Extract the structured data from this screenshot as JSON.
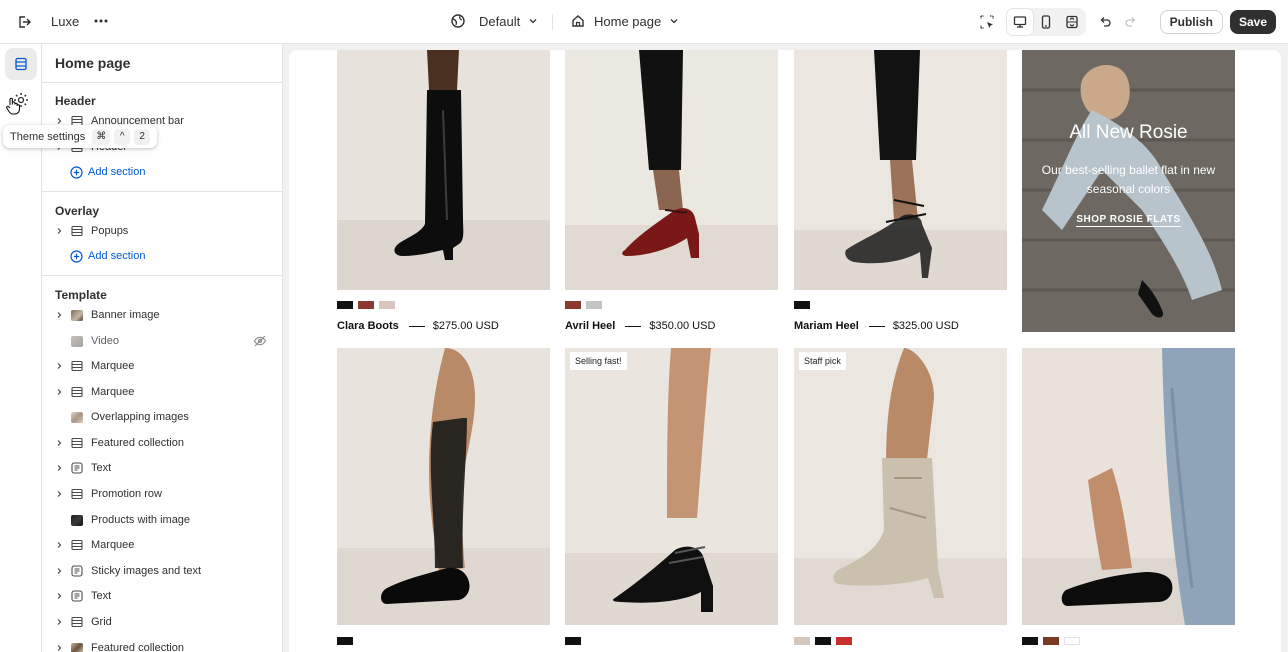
{
  "topbar": {
    "store_name": "Luxe",
    "theme_label": "Default",
    "page_label": "Home page",
    "publish_label": "Publish",
    "save_label": "Save"
  },
  "tooltip": {
    "label": "Theme settings",
    "keys": [
      "⌘",
      "^",
      "2"
    ]
  },
  "sidebar": {
    "title": "Home page",
    "groups": {
      "header": {
        "title": "Header",
        "items": [
          {
            "label": "Announcement bar",
            "icon": "section-icon"
          },
          {
            "label": "Header",
            "icon": "section-icon"
          }
        ],
        "add_label": "Add section"
      },
      "overlay": {
        "title": "Overlay",
        "items": [
          {
            "label": "Popups",
            "icon": "section-icon"
          }
        ],
        "add_label": "Add section"
      },
      "template": {
        "title": "Template",
        "items": [
          {
            "label": "Banner image",
            "icon": "image-thumb"
          },
          {
            "label": "Video",
            "icon": "video-thumb",
            "hidden": true
          },
          {
            "label": "Marquee",
            "icon": "section-icon"
          },
          {
            "label": "Marquee",
            "icon": "section-icon"
          },
          {
            "label": "Overlapping images",
            "icon": "image-thumb"
          },
          {
            "label": "Featured collection",
            "icon": "section-icon"
          },
          {
            "label": "Text",
            "icon": "text-icon"
          },
          {
            "label": "Promotion row",
            "icon": "section-icon"
          },
          {
            "label": "Products with image",
            "icon": "image-thumb"
          },
          {
            "label": "Marquee",
            "icon": "section-icon"
          },
          {
            "label": "Sticky images and text",
            "icon": "text-icon"
          },
          {
            "label": "Text",
            "icon": "text-icon"
          },
          {
            "label": "Grid",
            "icon": "section-icon"
          },
          {
            "label": "Featured collection",
            "icon": "image-thumb"
          }
        ]
      }
    }
  },
  "preview": {
    "products_row1": [
      {
        "name": "Clara Boots",
        "price": "$275.00 USD",
        "swatches": [
          "#111111",
          "#8b3a2e",
          "#d6c6bd"
        ]
      },
      {
        "name": "Avril Heel",
        "price": "$350.00 USD",
        "swatches": [
          "#8b3a2e",
          "#c4c4c4"
        ]
      },
      {
        "name": "Mariam Heel",
        "price": "$325.00 USD",
        "swatches": [
          "#111111"
        ]
      }
    ],
    "promo": {
      "heading": "All New Rosie",
      "subtext": "Our best-selling ballet flat in new seasonal colors",
      "link": "SHOP ROSIE FLATS"
    },
    "products_row2": [
      {
        "badge": "",
        "swatches": [
          "#111111"
        ]
      },
      {
        "badge": "Selling fast!",
        "swatches": [
          "#111111"
        ]
      },
      {
        "badge": "Staff pick",
        "swatches": [
          "#d6c6bd",
          "#111111",
          "#c8302b"
        ]
      },
      {
        "badge": "",
        "swatches": [
          "#111111",
          "#7a3b22",
          "#ffffff"
        ]
      }
    ]
  },
  "colors": {
    "accent_link": "#005bd3",
    "save_button": "#303030",
    "photo_bg": "#e8e2dc"
  }
}
